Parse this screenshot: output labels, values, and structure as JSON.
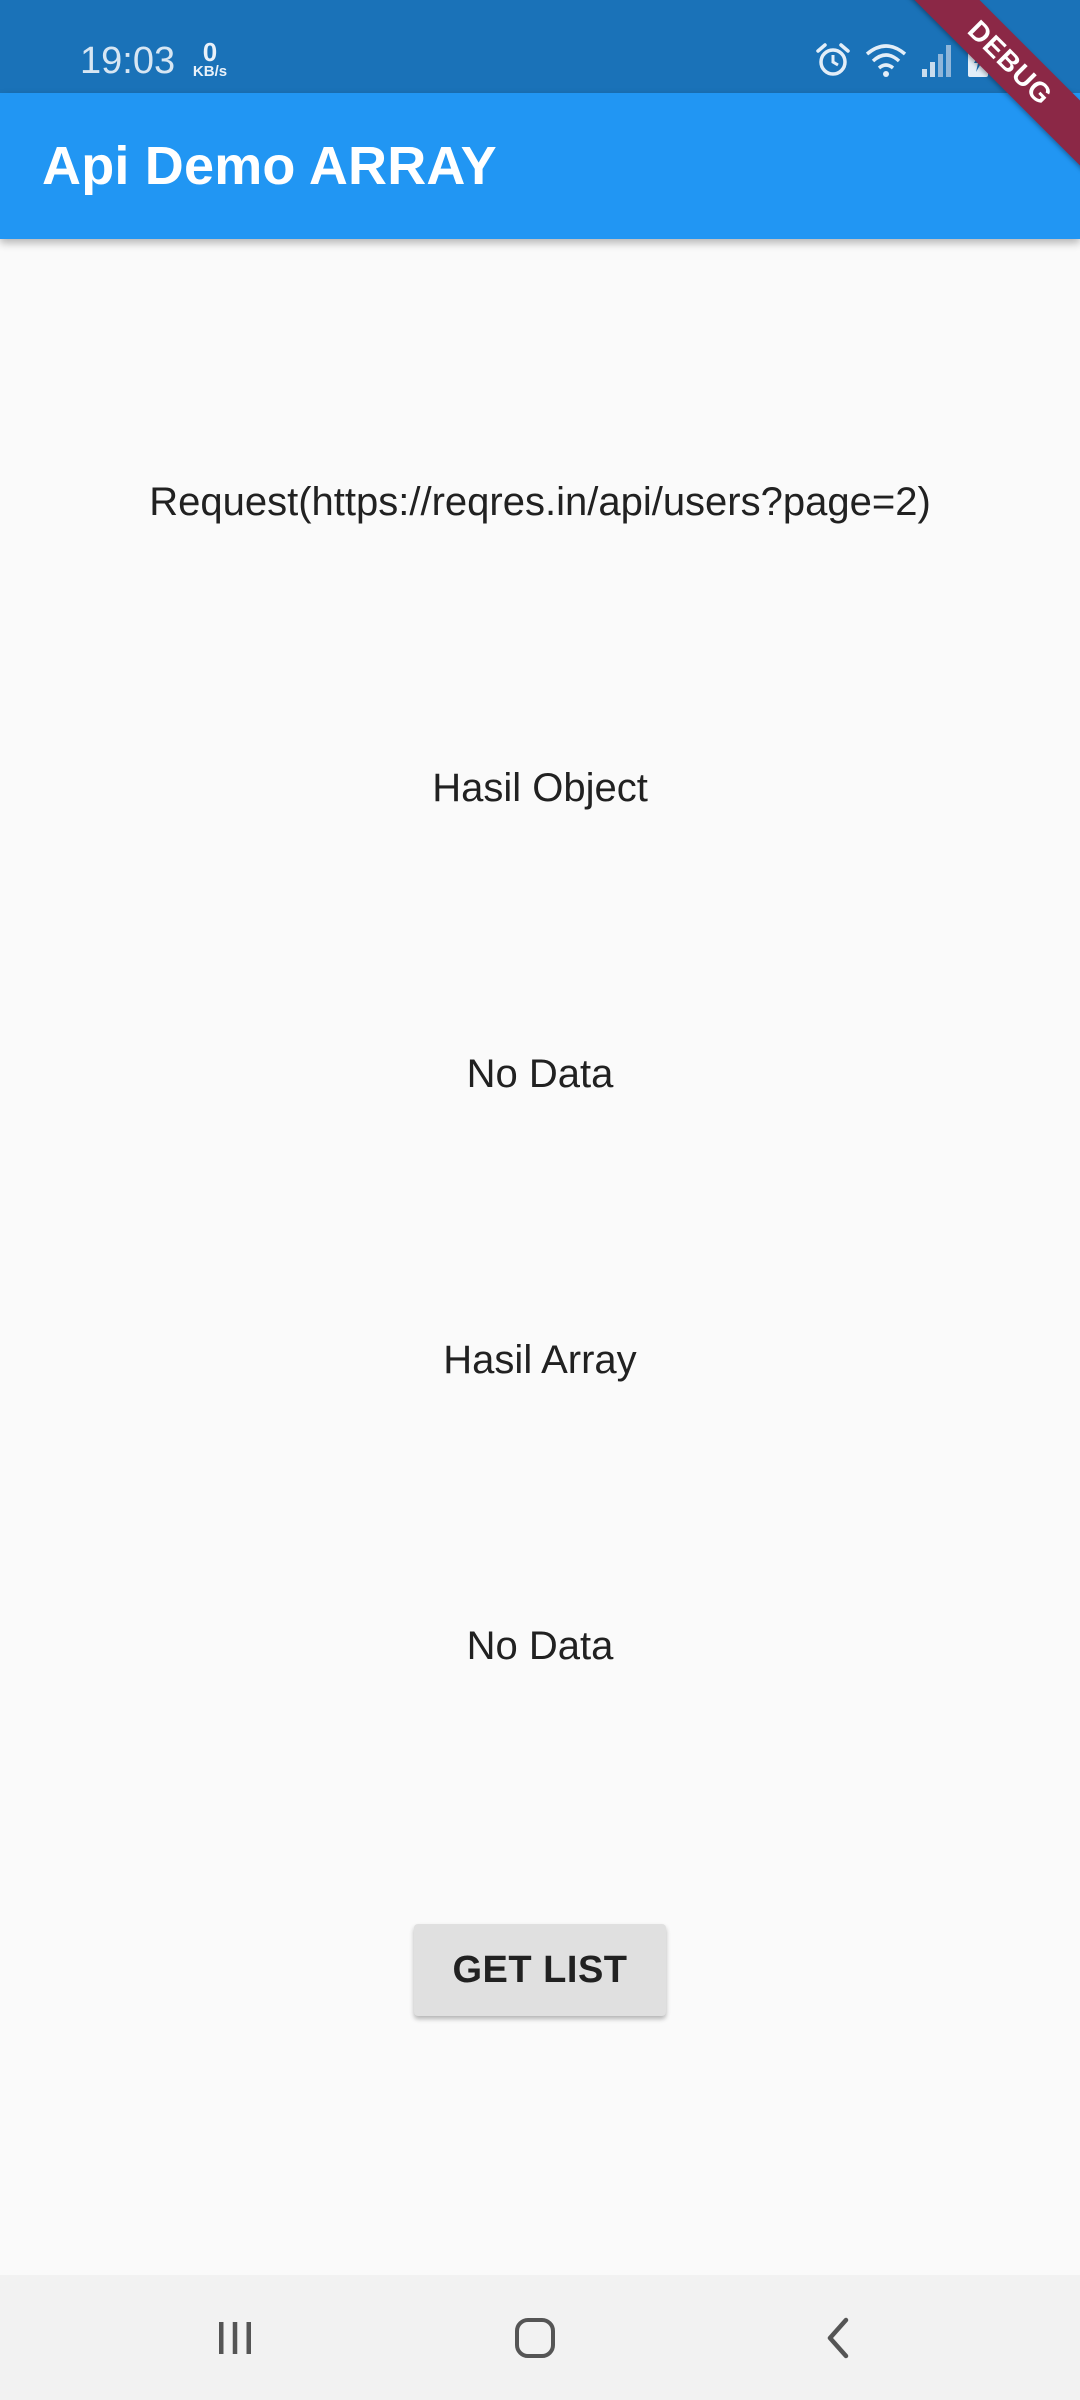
{
  "status_bar": {
    "time": "19:03",
    "net_speed": "0",
    "net_speed_unit": "KB/s",
    "icons": [
      "alarm-icon",
      "wifi-icon",
      "signal-icon",
      "battery-icon"
    ]
  },
  "debug_banner": "DEBUG",
  "app_bar": {
    "title": "Api Demo ARRAY"
  },
  "content": {
    "request_label": "Request(https://reqres.in/api/users?page=2)",
    "object_heading": "Hasil Object",
    "object_value": "No Data",
    "array_heading": "Hasil Array",
    "array_value": "No Data",
    "button_label": "GET LIST"
  },
  "nav_bar": {
    "icons": [
      "recent-apps-icon",
      "home-icon",
      "back-icon"
    ]
  },
  "colors": {
    "status_bar": "#1a72b8",
    "app_bar": "#2196f3",
    "background": "#fafafa",
    "button": "#e0e0e0",
    "debug_banner": "#8b2846"
  }
}
